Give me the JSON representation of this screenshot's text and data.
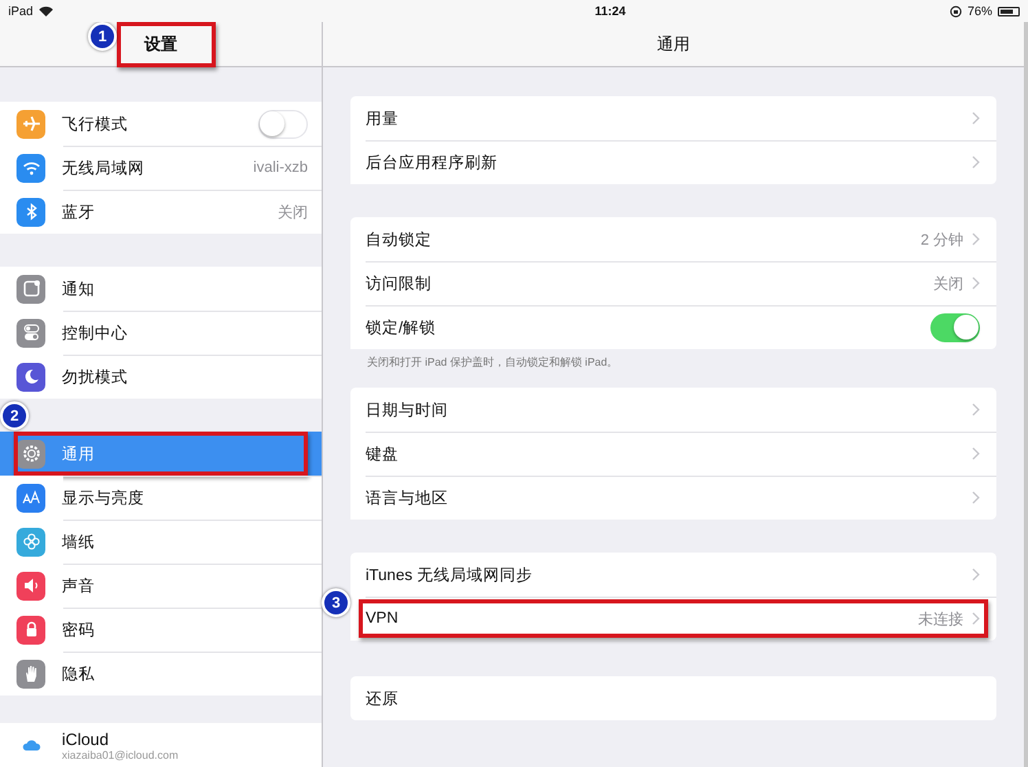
{
  "status_bar": {
    "device": "iPad",
    "time": "11:24",
    "battery": "76%"
  },
  "sidebar": {
    "title": "设置",
    "title_callout": "1",
    "groups": [
      [
        {
          "label": "飞行模式",
          "kind": "toggle",
          "on": false,
          "color": "#f5a033",
          "selected": false
        },
        {
          "label": "无线局域网",
          "kind": "value",
          "value": "ivali-xzb",
          "color": "#2a8cf0",
          "selected": false
        },
        {
          "label": "蓝牙",
          "kind": "value",
          "value": "关闭",
          "color": "#2a8cf0",
          "selected": false
        }
      ],
      [
        {
          "label": "通知",
          "kind": "plain",
          "color": "#8e8e93",
          "selected": false
        },
        {
          "label": "控制中心",
          "kind": "plain",
          "color": "#8e8e93",
          "selected": false
        },
        {
          "label": "勿扰模式",
          "kind": "plain",
          "color": "#5856d6",
          "selected": false
        }
      ],
      [
        {
          "label": "通用",
          "kind": "plain",
          "color": "#8e8e93",
          "selected": true,
          "callout": "2"
        },
        {
          "label": "显示与亮度",
          "kind": "plain",
          "color": "#2a7ff0",
          "selected": false
        },
        {
          "label": "墙纸",
          "kind": "plain",
          "color": "#35aadc",
          "selected": false
        },
        {
          "label": "声音",
          "kind": "plain",
          "color": "#f0405a",
          "selected": false
        },
        {
          "label": "密码",
          "kind": "plain",
          "color": "#f0405a",
          "selected": false
        },
        {
          "label": "隐私",
          "kind": "plain",
          "color": "#8e8e93",
          "selected": false
        }
      ],
      [
        {
          "label": "iCloud",
          "sublabel": "xiazaiba01@icloud.com",
          "kind": "account"
        }
      ]
    ]
  },
  "detail": {
    "title": "通用",
    "groups": [
      {
        "rows": [
          {
            "label": "用量",
            "kind": "link"
          },
          {
            "label": "后台应用程序刷新",
            "kind": "link"
          }
        ]
      },
      {
        "rows": [
          {
            "label": "自动锁定",
            "kind": "link",
            "value": "2 分钟"
          },
          {
            "label": "访问限制",
            "kind": "link",
            "value": "关闭"
          },
          {
            "label": "锁定/解锁",
            "kind": "toggle",
            "on": true
          }
        ],
        "footer": "关闭和打开 iPad 保护盖时，自动锁定和解锁 iPad。"
      },
      {
        "rows": [
          {
            "label": "日期与时间",
            "kind": "link"
          },
          {
            "label": "键盘",
            "kind": "link"
          },
          {
            "label": "语言与地区",
            "kind": "link"
          }
        ]
      },
      {
        "rows": [
          {
            "label": "iTunes 无线局域网同步",
            "kind": "link"
          },
          {
            "label": "VPN",
            "kind": "link",
            "value": "未连接",
            "callout": "3"
          }
        ]
      },
      {
        "rows": [
          {
            "label": "还原",
            "kind": "plain"
          }
        ]
      }
    ]
  }
}
